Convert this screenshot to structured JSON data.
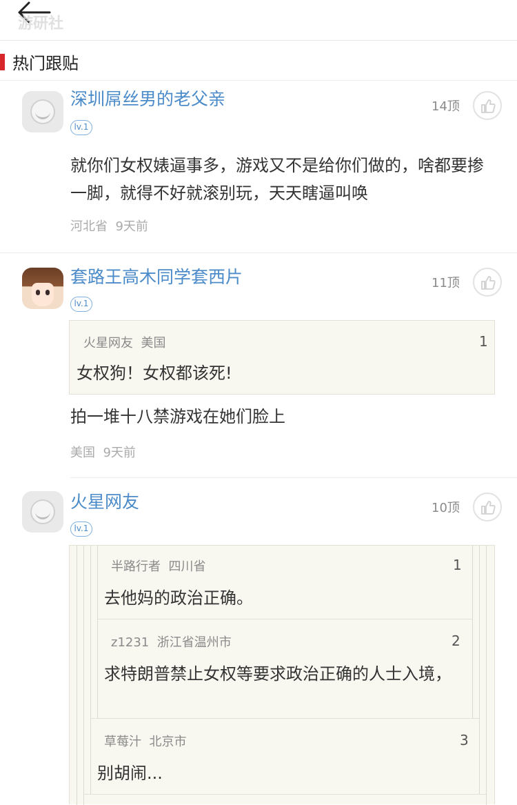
{
  "header": {
    "back_icon": "back-arrow-icon",
    "watermark": "游研社"
  },
  "section": {
    "title": "热门跟贴"
  },
  "comments": [
    {
      "username": "深圳屌丝男的老父亲",
      "level": "lv.1",
      "likes": "14顶",
      "text": "就你们女权婊逼事多，游戏又不是给你们做的，啥都要掺一脚，就得不好就滚别玩，天天瞎逼叫唤",
      "location": "河北省",
      "time": "9天前"
    },
    {
      "username": "套路王高木同学套西片",
      "level": "lv.1",
      "likes": "11顶",
      "quote": {
        "author": "火星网友",
        "location": "美国",
        "index": "1",
        "text": "女权狗！女权都该死!"
      },
      "text": "拍一堆十八禁游戏在她们脸上",
      "location": "美国",
      "time": "9天前"
    },
    {
      "username": "火星网友",
      "level": "lv.1",
      "likes": "10顶",
      "quotes": [
        {
          "author": "半路行者",
          "location": "四川省",
          "index": "1",
          "text": "去他妈的政治正确。"
        },
        {
          "author": "z1231",
          "location": "浙江省温州市",
          "index": "2",
          "text": "求特朗普禁止女权等要求政治正确的人士入境，"
        },
        {
          "author": "草莓汁",
          "location": "北京市",
          "index": "3",
          "text": "别胡闹..."
        }
      ]
    }
  ]
}
